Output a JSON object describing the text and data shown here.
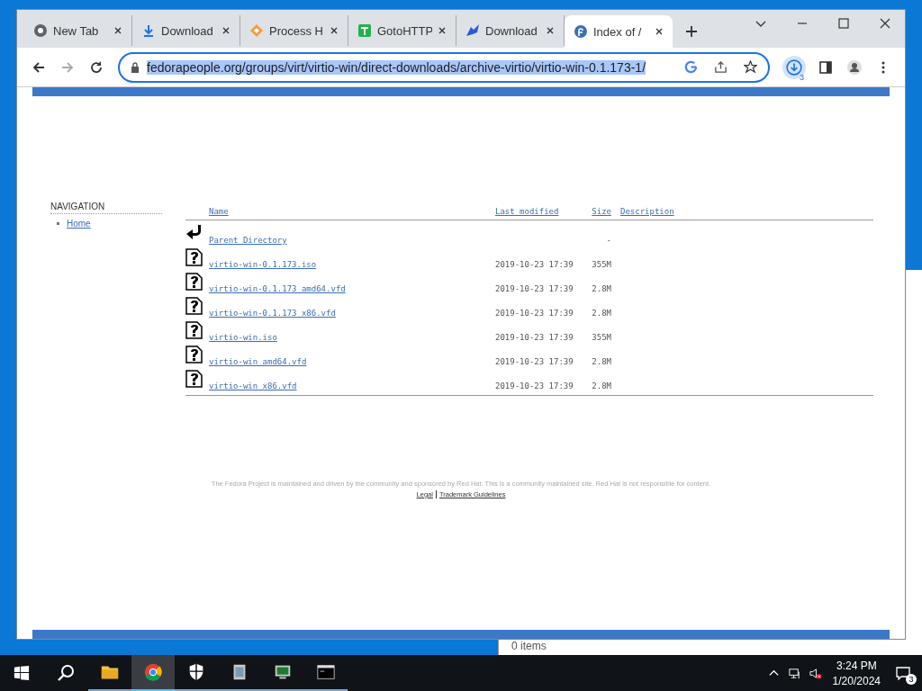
{
  "browser": {
    "tabs": [
      {
        "label": "New Tab",
        "kind": "chrome",
        "selected": false
      },
      {
        "label": "Download",
        "kind": "download",
        "selected": false
      },
      {
        "label": "Process H",
        "kind": "diamond",
        "selected": false
      },
      {
        "label": "GotoHTTP",
        "kind": "t",
        "selected": false
      },
      {
        "label": "Download",
        "kind": "bird",
        "selected": false
      },
      {
        "label": "Index of /",
        "kind": "fedora",
        "selected": true
      }
    ],
    "address": "fedorapeople.org/groups/virt/virtio-win/direct-downloads/archive-virtio/virtio-win-0.1.173-1/",
    "downloads_count": "3"
  },
  "page": {
    "navigation": {
      "title": "NAVIGATION",
      "items": [
        "Home"
      ]
    },
    "listing": {
      "columns": [
        "Name",
        "Last modified",
        "Size",
        "Description"
      ],
      "rows": [
        {
          "kind": "parent",
          "name": "Parent Directory",
          "modified": "",
          "size": "-"
        },
        {
          "kind": "file",
          "name": "virtio-win-0.1.173.iso",
          "modified": "2019-10-23 17:39",
          "size": "355M"
        },
        {
          "kind": "file",
          "name": "virtio-win-0.1.173_amd64.vfd",
          "modified": "2019-10-23 17:39",
          "size": "2.8M"
        },
        {
          "kind": "file",
          "name": "virtio-win-0.1.173_x86.vfd",
          "modified": "2019-10-23 17:39",
          "size": "2.8M"
        },
        {
          "kind": "file",
          "name": "virtio-win.iso",
          "modified": "2019-10-23 17:39",
          "size": "355M"
        },
        {
          "kind": "file",
          "name": "virtio-win_amd64.vfd",
          "modified": "2019-10-23 17:39",
          "size": "2.8M"
        },
        {
          "kind": "file",
          "name": "virtio-win_x86.vfd",
          "modified": "2019-10-23 17:39",
          "size": "2.8M"
        }
      ]
    },
    "footer": {
      "text": "The Fedora Project is maintained and driven by the community and sponsored by Red Hat. This is a community maintained site. Red Hat is not responsible for content.",
      "links": [
        "Legal",
        "Trademark Guidelines"
      ]
    }
  },
  "background_window": {
    "status": "0 items"
  },
  "taskbar": {
    "apps": [
      {
        "kind": "explorer",
        "selected": false
      },
      {
        "kind": "chrome",
        "selected": true
      },
      {
        "kind": "shield",
        "selected": false
      },
      {
        "kind": "package",
        "selected": false
      },
      {
        "kind": "monitor",
        "selected": false
      },
      {
        "kind": "terminal",
        "selected": false
      }
    ],
    "time": "3:24 PM",
    "date": "1/20/2024",
    "notifications": "3"
  }
}
